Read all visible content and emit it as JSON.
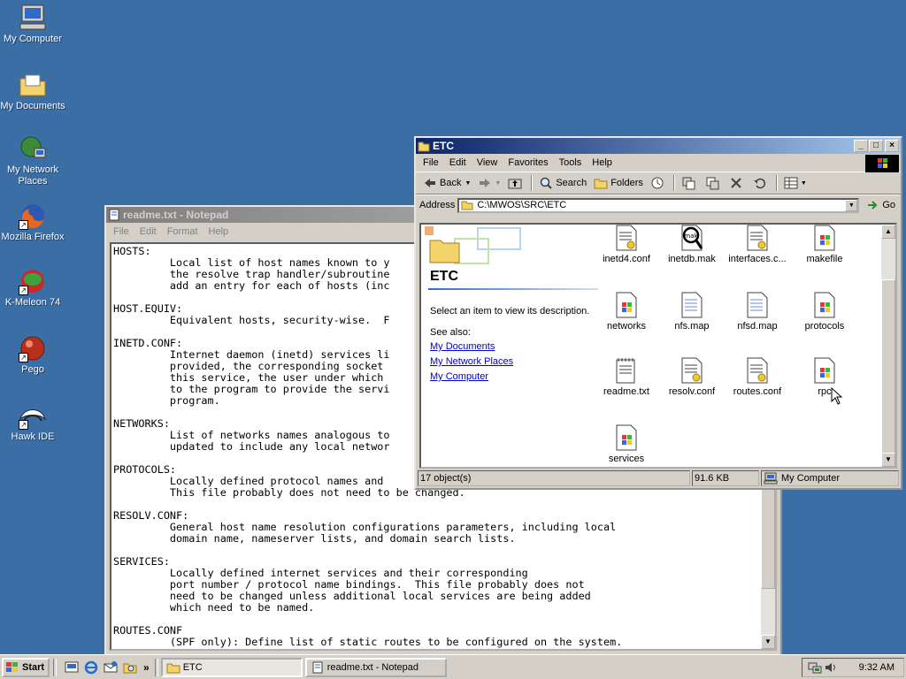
{
  "desktop": {
    "icons": [
      {
        "label": "My Computer"
      },
      {
        "label": "My Documents"
      },
      {
        "label": "My Network Places"
      },
      {
        "label": "Mozilla Firefox"
      },
      {
        "label": "K-Meleon 74"
      },
      {
        "label": "Pego"
      },
      {
        "label": "Hawk IDE"
      }
    ]
  },
  "notepad": {
    "title": "readme.txt - Notepad",
    "menu": [
      "File",
      "Edit",
      "Format",
      "Help"
    ],
    "content": "HOSTS:\n         Local list of host names known to y\n         the resolve trap handler/subroutine\n         add an entry for each of hosts (inc\n\nHOST.EQUIV:\n         Equivalent hosts, security-wise.  F\n\nINETD.CONF:\n         Internet daemon (inetd) services li\n         provided, the corresponding socket \n         this service, the user under which \n         to the program to provide the servi\n         program.\n\nNETWORKS:\n         List of networks names analogous to\n         updated to include any local networ\n\nPROTOCOLS:\n         Locally defined protocol names and \n         This file probably does not need to be changed.\n\nRESOLV.CONF:\n         General host name resolution configurations parameters, including local\n         domain name, nameserver lists, and domain search lists.\n\nSERVICES:\n         Locally defined internet services and their corresponding\n         port number / protocol name bindings.  This file probably does not\n         need to be changed unless additional local services are being added\n         which need to be named.\n\nROUTES.CONF\n         (SPF only): Define list of static routes to be configured on the system."
  },
  "explorer": {
    "title": "ETC",
    "menu": [
      "File",
      "Edit",
      "View",
      "Favorites",
      "Tools",
      "Help"
    ],
    "toolbar": {
      "back": "Back",
      "search": "Search",
      "folders": "Folders"
    },
    "address_label": "Address",
    "address_value": "C:\\MWOS\\SRC\\ETC",
    "go_label": "Go",
    "folder_title": "ETC",
    "description": "Select an item to view its description.",
    "see_also": "See also:",
    "links": [
      "My Documents",
      "My Network Places",
      "My Computer"
    ],
    "files": [
      {
        "name": "inetd4.conf",
        "type": "conf"
      },
      {
        "name": "inetdb.mak",
        "type": "mak"
      },
      {
        "name": "interfaces.c...",
        "type": "conf"
      },
      {
        "name": "makefile",
        "type": "win"
      },
      {
        "name": "networks",
        "type": "win"
      },
      {
        "name": "nfs.map",
        "type": "doc"
      },
      {
        "name": "nfsd.map",
        "type": "doc"
      },
      {
        "name": "protocols",
        "type": "win"
      },
      {
        "name": "readme.txt",
        "type": "txt"
      },
      {
        "name": "resolv.conf",
        "type": "conf"
      },
      {
        "name": "routes.conf",
        "type": "conf"
      },
      {
        "name": "rpc",
        "type": "win"
      },
      {
        "name": "services",
        "type": "win"
      }
    ],
    "status": {
      "objects": "17 object(s)",
      "size": "91.6 KB",
      "zone": "My Computer"
    }
  },
  "taskbar": {
    "start_label": "Start",
    "tasks": [
      {
        "label": "ETC"
      },
      {
        "label": "readme.txt - Notepad"
      }
    ],
    "clock": "9:32 AM",
    "chevron": "»"
  }
}
